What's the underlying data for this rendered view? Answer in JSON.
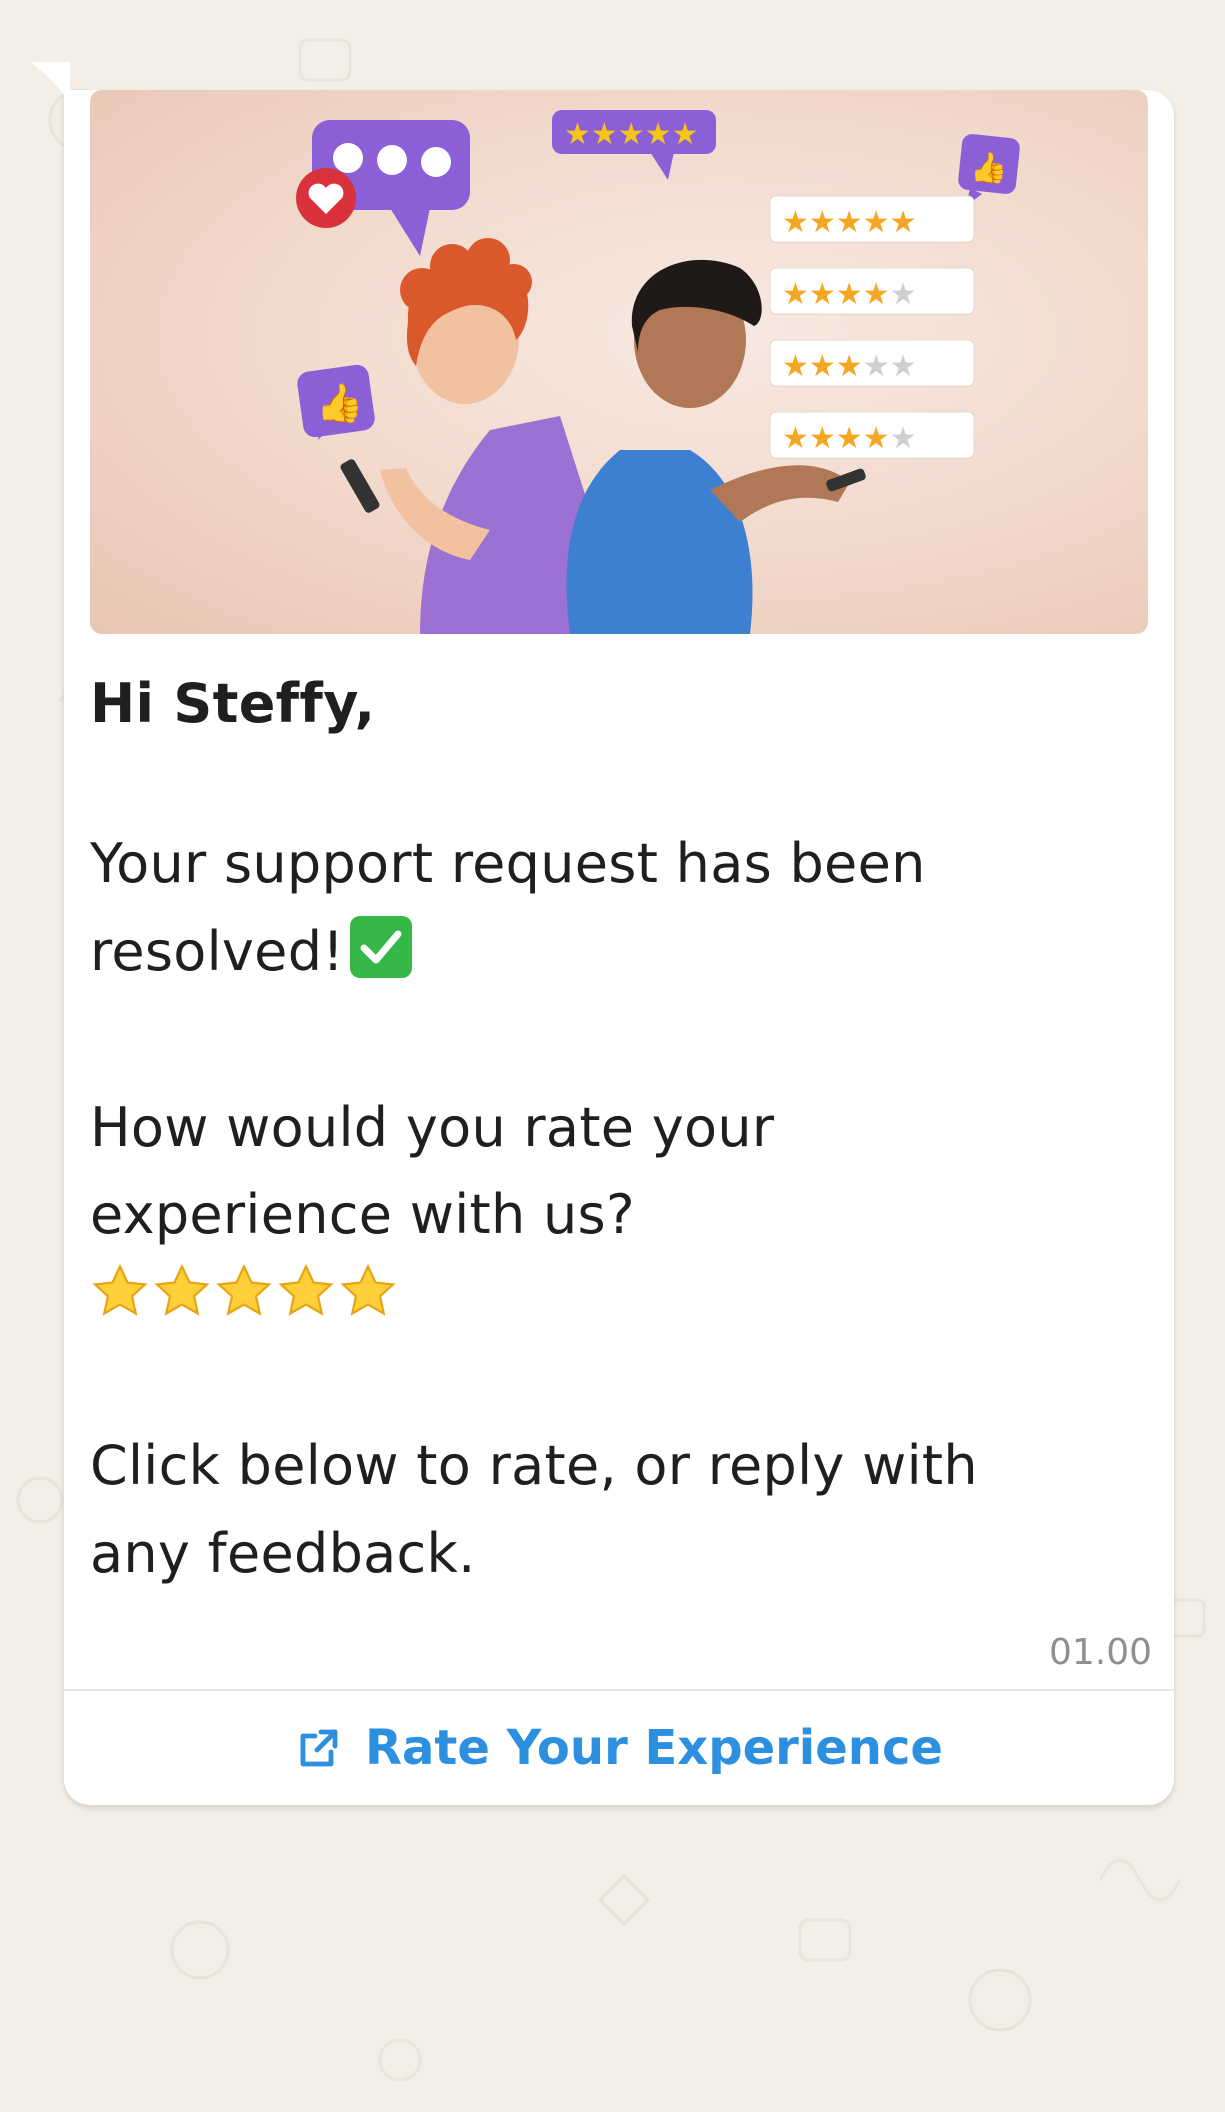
{
  "message": {
    "greeting": "Hi Steffy,",
    "line1": "Your support request has been",
    "line2": "resolved!",
    "line3": "How would you rate your",
    "line4": "experience with us?",
    "line5": "Click below to rate, or reply with",
    "line6": "any feedback.",
    "timestamp": "01.00",
    "status_emoji": "check-mark-button-icon",
    "rating_stars_shown": 5
  },
  "cta": {
    "label": "Rate Your Experience",
    "icon": "external-link-icon",
    "color": "#2c8fdf"
  },
  "hero": {
    "rating_cards": [
      5,
      4,
      3,
      4
    ]
  },
  "colors": {
    "background": "#f3efe6",
    "bubble": "#ffffff",
    "check": "#35b847",
    "star": "#f5a623",
    "purple": "#8b5fd6"
  }
}
